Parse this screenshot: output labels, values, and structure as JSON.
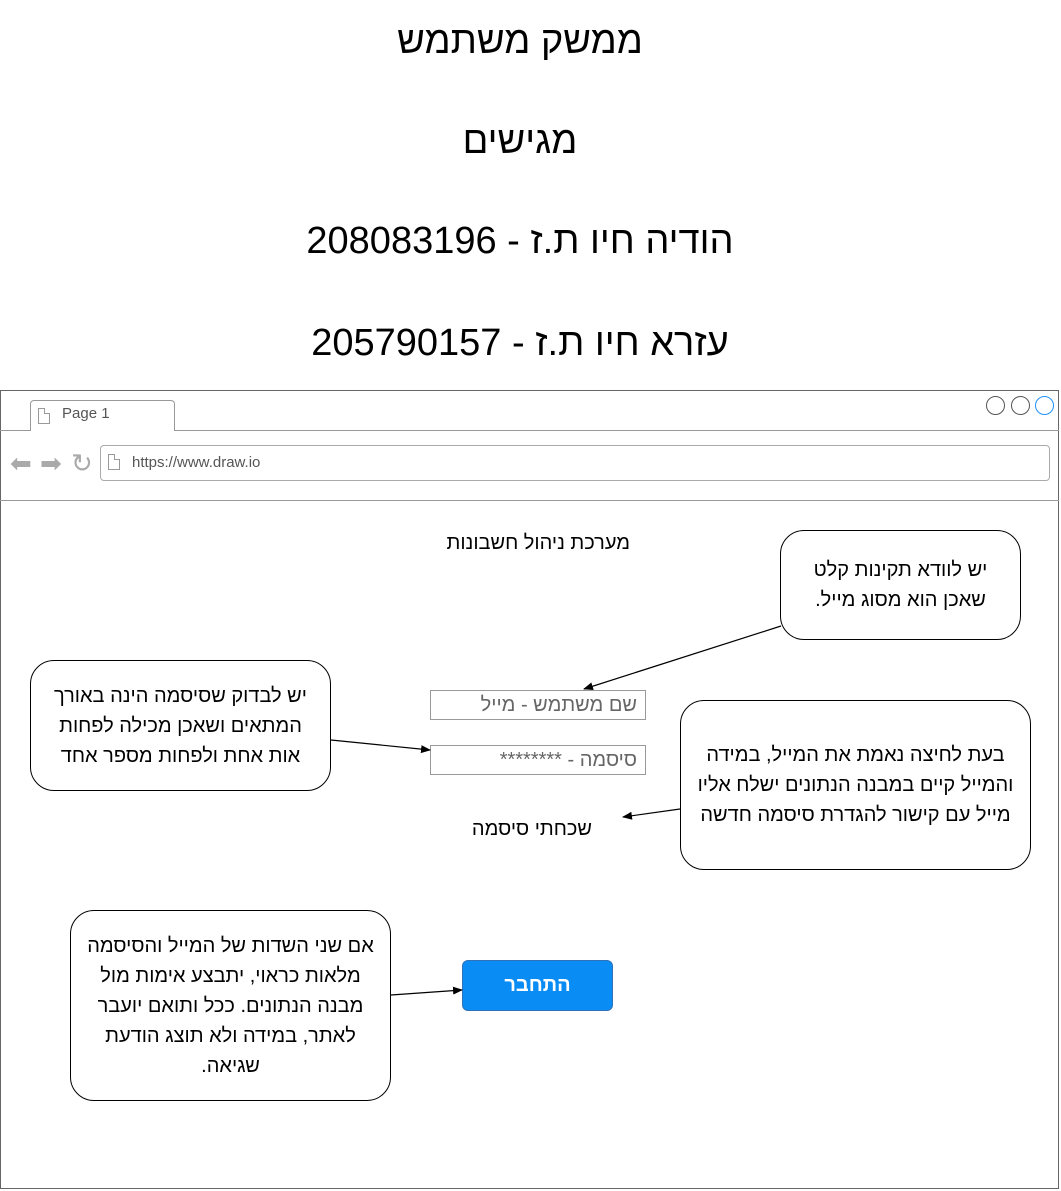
{
  "header": {
    "lines": [
      "ממשק משתמש",
      "מגישים",
      "הודיה חיו ת.ז - 208083196",
      "עזרא חיו ת.ז - 205790157"
    ]
  },
  "browser": {
    "tab_label": "Page 1",
    "url": "https://www.draw.io"
  },
  "app": {
    "title": "מערכת ניהול חשבונות",
    "username_placeholder": "שם משתמש - מייל",
    "password_placeholder": "סיסמה - ********",
    "forgot_password": "שכחתי סיסמה",
    "login_button": "התחבר"
  },
  "notes": {
    "email_validation": "יש לוודא תקינות קלט שאכן הוא מסוג מייל.",
    "password_validation": "יש לבדוק שסיסמה הינה באורך המתאים ושאכן מכילה לפחות אות אחת ולפחות מספר אחד",
    "forgot_flow": "בעת לחיצה נאמת את המייל, במידה והמייל קיים במבנה הנתונים ישלח אליו מייל עם קישור להגדרת סיסמה חדשה",
    "login_flow": "אם שני השדות של המייל והסיסמה מלאות כראוי, יתבצע אימות מול מבנה הנתונים. ככל ותואם יועבר לאתר, במידה ולא תוצג הודעת שגיאה."
  },
  "colors": {
    "login_button_bg": "#0a8cf5",
    "window_button_active": "#1e90ff"
  }
}
